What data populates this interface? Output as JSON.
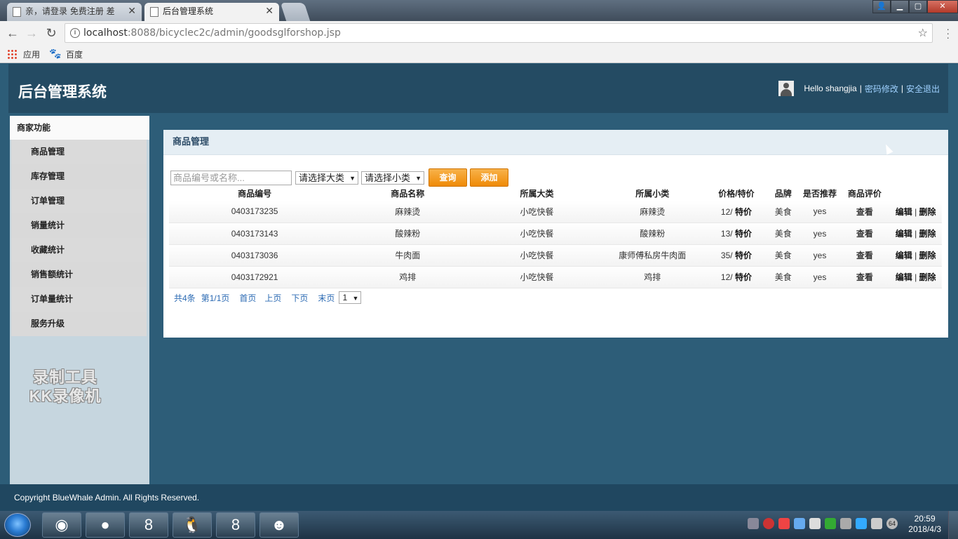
{
  "browser": {
    "tabs": [
      {
        "title": "亲，请登录 免费注册 差",
        "active": false
      },
      {
        "title": "后台管理系统",
        "active": true
      }
    ],
    "url_host": "localhost",
    "url_rest": ":8088/bicyclec2c/admin/goodsglforshop.jsp",
    "bookmarks": [
      "应用",
      "百度"
    ]
  },
  "header": {
    "brand": "后台管理系统",
    "greeting": "Hello shangjia",
    "sep": "|",
    "change_password": "密码修改",
    "logout": "安全退出"
  },
  "sidebar": {
    "title": "商家功能",
    "items": [
      "商品管理",
      "库存管理",
      "订单管理",
      "销量统计",
      "收藏统计",
      "销售额统计",
      "订单量统计",
      "服务升级"
    ]
  },
  "watermark": {
    "line1": "录制工具",
    "line2": "KK录像机"
  },
  "panel": {
    "title": "商品管理",
    "search_placeholder": "商品编号或名称...",
    "category_select": "请选择大类",
    "subcategory_select": "请选择小类",
    "query_button": "查询",
    "add_button": "添加"
  },
  "table": {
    "columns": [
      "商品编号",
      "商品名称",
      "所属大类",
      "所属小类",
      "价格/特价",
      "品牌",
      "是否推荐",
      "商品评价",
      ""
    ],
    "rows": [
      {
        "id": "0403173235",
        "name": "麻辣烫",
        "category": "小吃快餐",
        "subcategory": "麻辣烫",
        "price": "12/",
        "special": "特价",
        "brand": "美食",
        "recommended": "yes",
        "review": "查看",
        "edit": "编辑",
        "sep": "|",
        "delete": "删除"
      },
      {
        "id": "0403173143",
        "name": "酸辣粉",
        "category": "小吃快餐",
        "subcategory": "酸辣粉",
        "price": "13/",
        "special": "特价",
        "brand": "美食",
        "recommended": "yes",
        "review": "查看",
        "edit": "编辑",
        "sep": "|",
        "delete": "删除"
      },
      {
        "id": "0403173036",
        "name": "牛肉面",
        "category": "小吃快餐",
        "subcategory": "康师傅私房牛肉面",
        "price": "35/",
        "special": "特价",
        "brand": "美食",
        "recommended": "yes",
        "review": "查看",
        "edit": "编辑",
        "sep": "|",
        "delete": "删除"
      },
      {
        "id": "0403172921",
        "name": "鸡排",
        "category": "小吃快餐",
        "subcategory": "鸡排",
        "price": "12/",
        "special": "特价",
        "brand": "美食",
        "recommended": "yes",
        "review": "查看",
        "edit": "编辑",
        "sep": "|",
        "delete": "删除"
      }
    ]
  },
  "pager": {
    "total": "共4条",
    "page_info": "第1/1页",
    "first": "首页",
    "prev": "上页",
    "next": "下页",
    "last": "末页",
    "page_select": "1"
  },
  "footer": {
    "copyright": "Copyright BlueWhale Admin. All Rights Reserved."
  },
  "taskbar": {
    "time": "20:59",
    "date": "2018/4/3",
    "tray_number": "64"
  }
}
